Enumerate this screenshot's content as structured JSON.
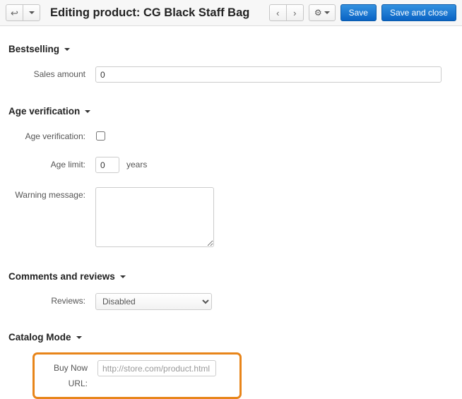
{
  "toolbar": {
    "back_icon": "back-arrow-icon",
    "back_label": "↩",
    "back_dropdown_icon": "chevron-down-icon",
    "title": "Editing product: CG Black Staff Bag",
    "prev_label": "‹",
    "next_label": "›",
    "gear_label": "⚙",
    "save_label": "Save",
    "save_close_label": "Save and close",
    "accent_blue": "#0a63c4"
  },
  "sections": {
    "bestselling": {
      "heading": "Bestselling",
      "sales_amount_label": "Sales amount",
      "sales_amount_value": "0"
    },
    "age_verification": {
      "heading": "Age verification",
      "checkbox_label": "Age verification:",
      "checkbox_checked": false,
      "age_limit_label": "Age limit:",
      "age_limit_value": "0",
      "age_limit_unit": "years",
      "warning_label": "Warning message:",
      "warning_value": ""
    },
    "comments_reviews": {
      "heading": "Comments and reviews",
      "reviews_label": "Reviews:",
      "reviews_selected": "Disabled",
      "reviews_options": [
        "Disabled"
      ]
    },
    "catalog_mode": {
      "heading": "Catalog Mode",
      "buy_now_label": "Buy Now URL:",
      "buy_now_placeholder": "http://store.com/product.html",
      "buy_now_value": "",
      "highlight_color": "#e8851a"
    }
  }
}
